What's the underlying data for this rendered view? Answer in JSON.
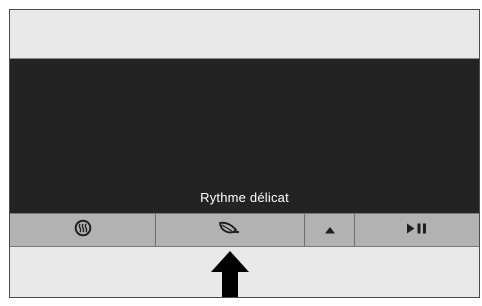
{
  "display": {
    "mode_label": "Rythme délicat"
  },
  "buttons": [
    {
      "icon": "heat-waves-icon"
    },
    {
      "icon": "leaf-mode-icon"
    },
    {
      "icon": "up-triangle-icon"
    },
    {
      "icon": "play-pause-icon"
    }
  ],
  "colors": {
    "screen": "#232323",
    "button_bar": "#b2b2b2",
    "panel": "#e9e9e9",
    "icon": "#1e1e1e"
  }
}
